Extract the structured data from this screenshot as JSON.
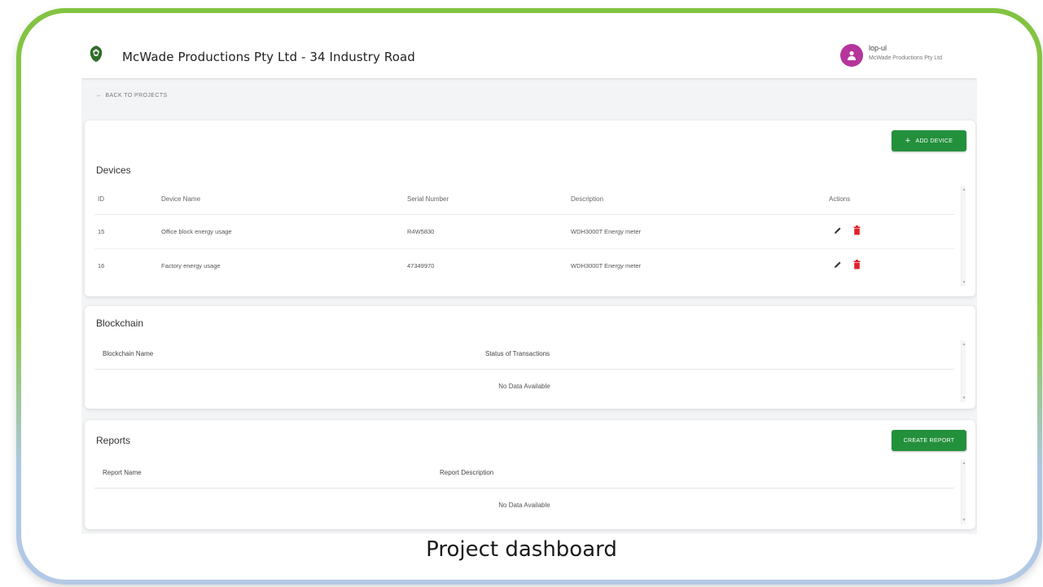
{
  "header": {
    "title": "McWade Productions Pty Ltd - 34 Industry Road",
    "user_name": "lop-ul",
    "user_org": "McWade Productions Pty Ltd"
  },
  "nav": {
    "back_label": "BACK TO PROJECTS"
  },
  "devices": {
    "title": "Devices",
    "add_button": "ADD DEVICE",
    "columns": [
      "ID",
      "Device Name",
      "Serial Number",
      "Description",
      "Actions"
    ],
    "rows": [
      {
        "id": "15",
        "name": "Office block energy usage",
        "serial": "R4W5830",
        "description": "WDH3000T Energy meter"
      },
      {
        "id": "16",
        "name": "Factory energy usage",
        "serial": "47349970",
        "description": "WDH3000T Energy meter"
      }
    ]
  },
  "blockchain": {
    "title": "Blockchain",
    "columns": [
      "Blockchain Name",
      "Status of Transactions"
    ],
    "empty_text": "No Data Available"
  },
  "reports": {
    "title": "Reports",
    "create_button": "CREATE REPORT",
    "columns": [
      "Report Name",
      "Report Description"
    ],
    "empty_text": "No Data Available"
  },
  "caption": "Project dashboard",
  "colors": {
    "accent_green": "#23903c",
    "frame_green": "#82c341",
    "frame_blue": "#b3c9e6",
    "delete_red": "#e0202a",
    "avatar": "#b5359b"
  }
}
